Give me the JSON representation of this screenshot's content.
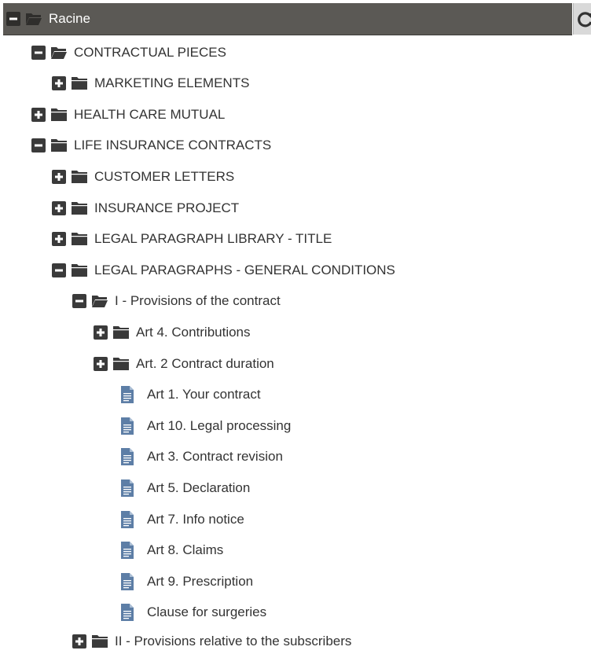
{
  "root": {
    "label": "Racine",
    "refresh_icon": "refresh-icon"
  },
  "nodes": [
    {
      "label": "CONTRACTUAL PIECES",
      "state": "expanded",
      "type": "folder"
    },
    {
      "label": "MARKETING ELEMENTS",
      "state": "collapsed",
      "type": "folder"
    },
    {
      "label": "HEALTH CARE MUTUAL",
      "state": "collapsed",
      "type": "folder"
    },
    {
      "label": "LIFE INSURANCE CONTRACTS",
      "state": "expanded",
      "type": "folder"
    },
    {
      "label": "CUSTOMER LETTERS",
      "state": "collapsed",
      "type": "folder"
    },
    {
      "label": "INSURANCE PROJECT",
      "state": "collapsed",
      "type": "folder"
    },
    {
      "label": "LEGAL PARAGRAPH LIBRARY - TITLE",
      "state": "collapsed",
      "type": "folder"
    },
    {
      "label": "LEGAL PARAGRAPHS - GENERAL CONDITIONS",
      "state": "expanded",
      "type": "folder"
    },
    {
      "label": "I - Provisions of the contract",
      "state": "expanded",
      "type": "folder"
    },
    {
      "label": "Art 4. Contributions",
      "state": "collapsed",
      "type": "folder"
    },
    {
      "label": "Art. 2 Contract duration",
      "state": "collapsed",
      "type": "folder"
    },
    {
      "label": "Art 1. Your contract",
      "type": "file"
    },
    {
      "label": "Art 10. Legal processing",
      "type": "file"
    },
    {
      "label": "Art 3. Contract revision",
      "type": "file"
    },
    {
      "label": "Art 5. Declaration",
      "type": "file"
    },
    {
      "label": "Art 7. Info notice",
      "type": "file"
    },
    {
      "label": "Art 8. Claims",
      "type": "file"
    },
    {
      "label": "Art 9. Prescription",
      "type": "file"
    },
    {
      "label": "Clause for surgeries",
      "type": "file"
    },
    {
      "label": "II - Provisions relative to the subscribers",
      "state": "collapsed",
      "type": "folder"
    }
  ],
  "colors": {
    "root_bar": "#5b5955",
    "icon_dark": "#3a3a3a",
    "file_icon": "#5d7ea6",
    "text": "#333333"
  }
}
